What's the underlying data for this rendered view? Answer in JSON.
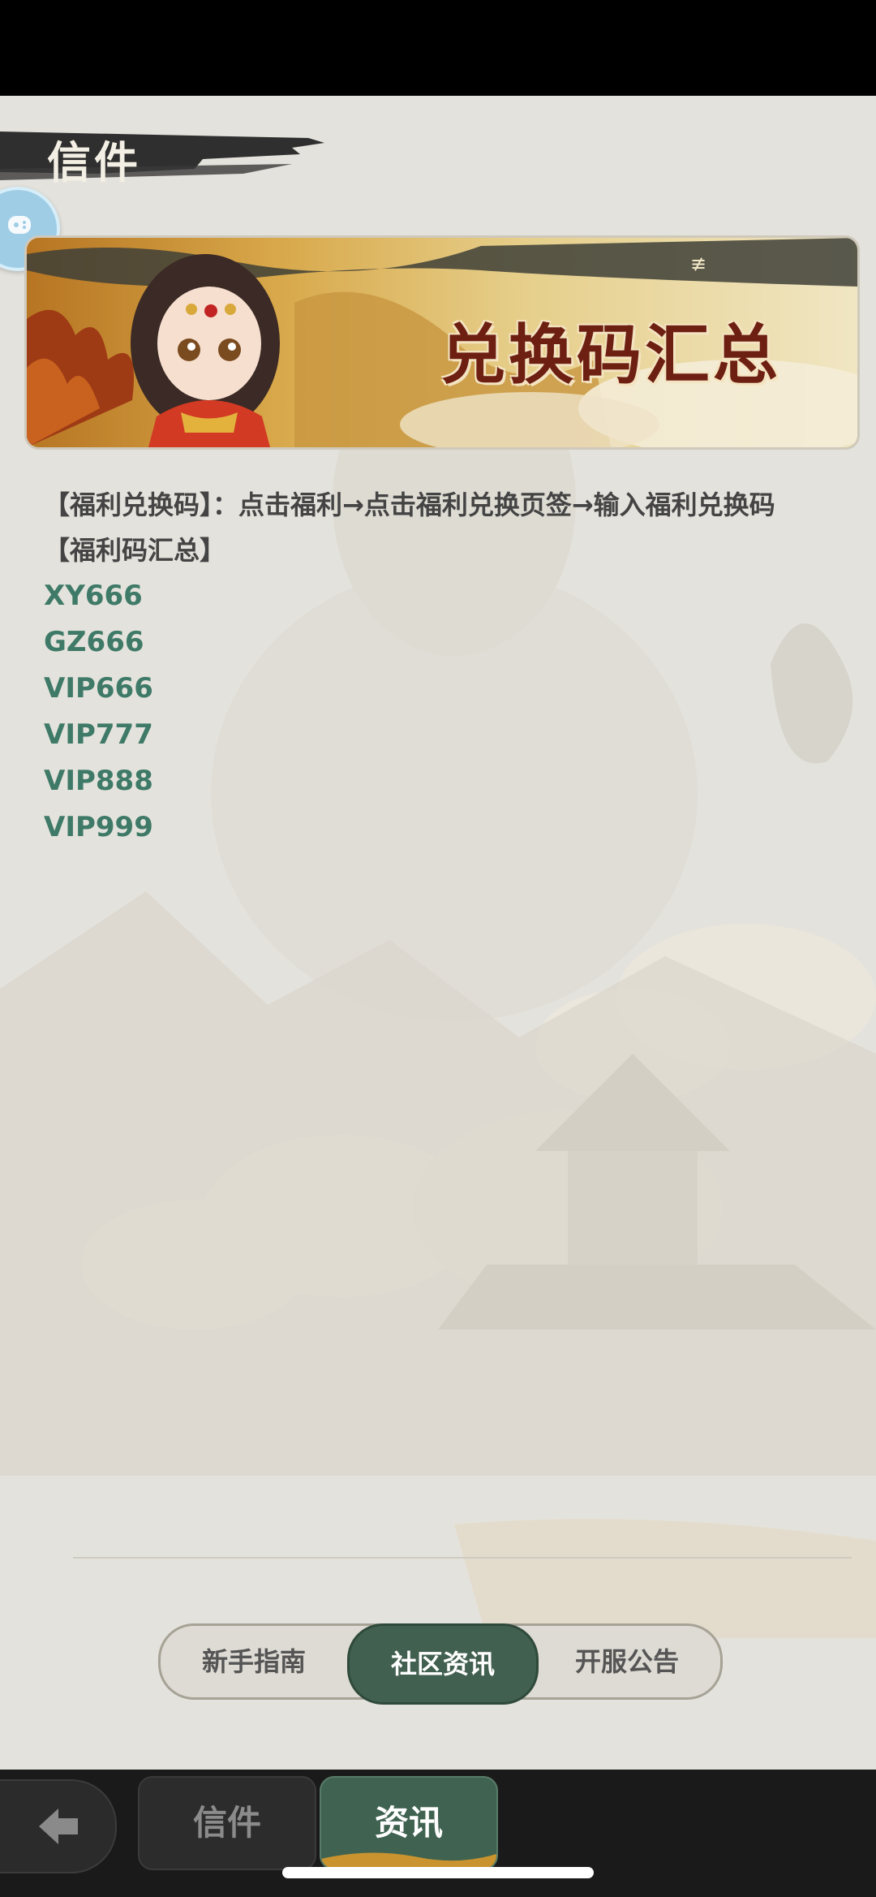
{
  "header": {
    "title": "信件"
  },
  "banner": {
    "title": "兑换码汇总",
    "badge_glyph": "≢"
  },
  "content": {
    "intro": "【福利兑换码】：点击福利→点击福利兑换页签→输入福利兑换码",
    "section_title": "【福利码汇总】",
    "codes": [
      "XY666",
      "GZ666",
      "VIP666",
      "VIP777",
      "VIP888",
      "VIP999"
    ]
  },
  "segment_tabs": [
    {
      "label": "新手指南",
      "active": false
    },
    {
      "label": "社区资讯",
      "active": true
    },
    {
      "label": "开服公告",
      "active": false
    }
  ],
  "bottom_nav": {
    "back_icon": "arrow-left-icon",
    "tabs": [
      {
        "label": "信件",
        "active": false
      },
      {
        "label": "资讯",
        "active": true
      }
    ]
  },
  "colors": {
    "accent_green": "#42604f",
    "code_green": "#3e7a67",
    "banner_title": "#6d1f12"
  }
}
